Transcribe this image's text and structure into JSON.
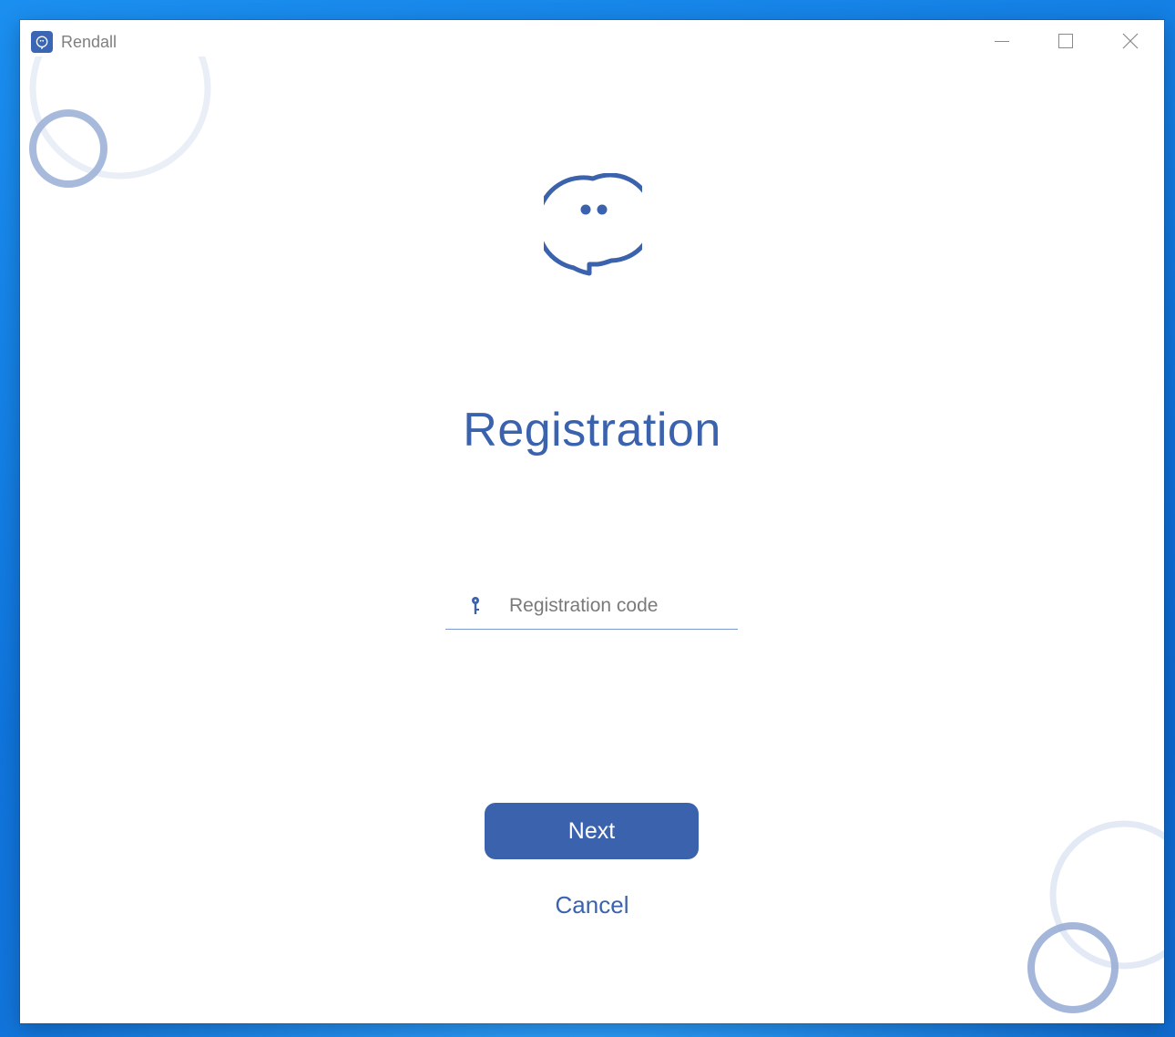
{
  "window": {
    "title": "Rendall",
    "icon": "rendall-logo-icon"
  },
  "titlebar_buttons": {
    "minimize": "minimize-icon",
    "maximize": "maximize-icon",
    "close": "close-icon"
  },
  "main": {
    "logo": "chat-bubble-logo-icon",
    "heading": "Registration",
    "code_field": {
      "icon": "key-icon",
      "placeholder": "Registration code",
      "value": ""
    },
    "next_label": "Next",
    "cancel_label": "Cancel"
  },
  "colors": {
    "accent": "#3a62ad",
    "desktop": "#0f6fd6",
    "placeholder": "#7a7a7a",
    "deco_circle_light": "#e6edf7",
    "deco_circle_dark": "#9db0d6"
  }
}
